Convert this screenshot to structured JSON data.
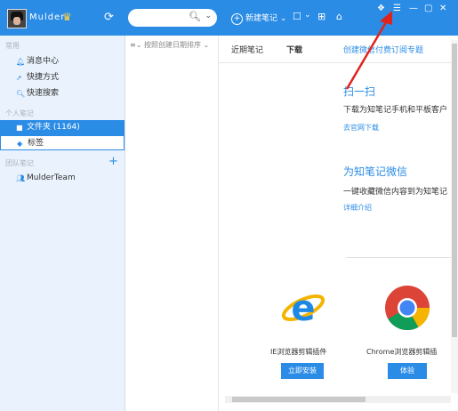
{
  "topbar": {
    "username": "Mulder",
    "search_placeholder": "",
    "new_note_label": "新建笔记"
  },
  "sidebar": {
    "section_common": "常用",
    "items_common": [
      {
        "label": "消息中心",
        "icon": "bell-icon"
      },
      {
        "label": "快捷方式",
        "icon": "rocket-icon"
      },
      {
        "label": "快速搜索",
        "icon": "magnifier-icon"
      }
    ],
    "section_personal": "个人笔记",
    "folder_label": "文件夹 (1164)",
    "tags_label": "标签",
    "section_team": "团队笔记",
    "team_item": "MulderTeam"
  },
  "list": {
    "sort_label": "按照创建日期排序"
  },
  "main": {
    "tabs": [
      "近期笔记",
      "下载",
      "创建微信付费订阅专题"
    ],
    "scan": {
      "title": "扫一扫",
      "desc": "下载为知笔记手机和平板客户",
      "link": "去官网下载"
    },
    "wechat": {
      "title": "为知笔记微信",
      "desc": "一键收藏微信内容到为知笔记",
      "link": "详细介绍"
    },
    "plugins": [
      {
        "name": "IE浏览器剪辑插件",
        "button": "立即安装"
      },
      {
        "name": "Chrome浏览器剪辑插",
        "button": "体验"
      }
    ]
  },
  "colors": {
    "accent": "#2b8ce6",
    "sidebar_bg": "#eaf3fd",
    "arrow": "#e0231c"
  }
}
